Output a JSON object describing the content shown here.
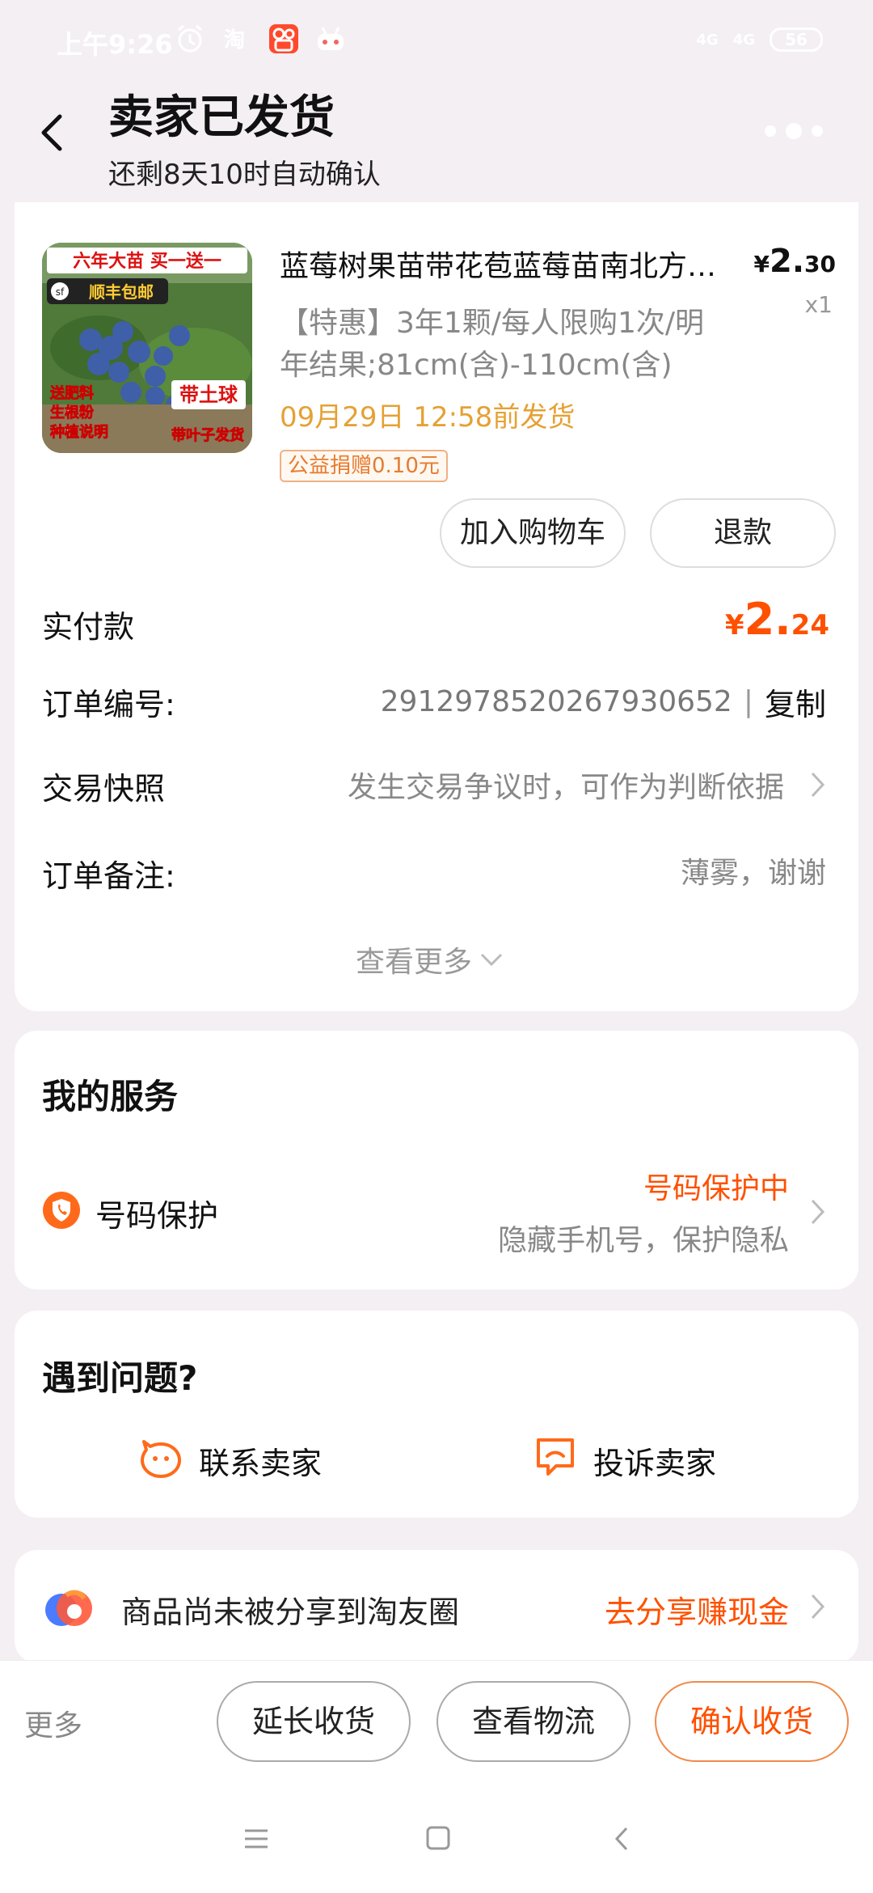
{
  "status_bar": {
    "time": "上午9:26",
    "signal1": "4G",
    "signal2": "4G",
    "battery": "56"
  },
  "header": {
    "title": "卖家已发货",
    "subtitle": "还剩8天10时自动确认"
  },
  "product": {
    "name": "蓝莓树果苗带花苞蓝莓苗南北方种植盆栽",
    "price_symbol": "¥",
    "price_int": "2.",
    "price_dec": "30",
    "qty": "x1",
    "spec": "【特惠】3年1颗/每人限购1次/明年结果;81cm(含)-110cm(含)",
    "ship_time": "09月29日 12:58前发货",
    "donate": "公益捐赠0.10元",
    "image_texts": [
      "六年大苗 买一送一",
      "顺丰包邮",
      "送肥料",
      "生根粉",
      "种植说明",
      "带土球",
      "带叶子发货"
    ],
    "add_cart": "加入购物车",
    "refund": "退款"
  },
  "order": {
    "paid_label": "实付款",
    "paid_symbol": "¥",
    "paid_int": "2.",
    "paid_dec": "24",
    "order_no_label": "订单编号:",
    "order_no": "2912978520267930652",
    "separator": "|",
    "copy": "复制",
    "snapshot_label": "交易快照",
    "snapshot_value": "发生交易争议时，可作为判断依据",
    "note_label": "订单备注:",
    "note_value": "薄雾，谢谢",
    "see_more": "查看更多"
  },
  "services": {
    "title": "我的服务",
    "phone_label": "号码保护",
    "protect_status": "号码保护中",
    "protect_desc": "隐藏手机号，保护隐私"
  },
  "problems": {
    "title": "遇到问题?",
    "contact": "联系卖家",
    "complain": "投诉卖家"
  },
  "share": {
    "text": "商品尚未被分享到淘友圈",
    "action": "去分享赚现金"
  },
  "bottom": {
    "more": "更多",
    "extend": "延长收货",
    "logistics": "查看物流",
    "confirm": "确认收货"
  },
  "colors": {
    "accent": "#ff5000",
    "ship_time": "#e5a135",
    "background": "#f4eff3"
  }
}
